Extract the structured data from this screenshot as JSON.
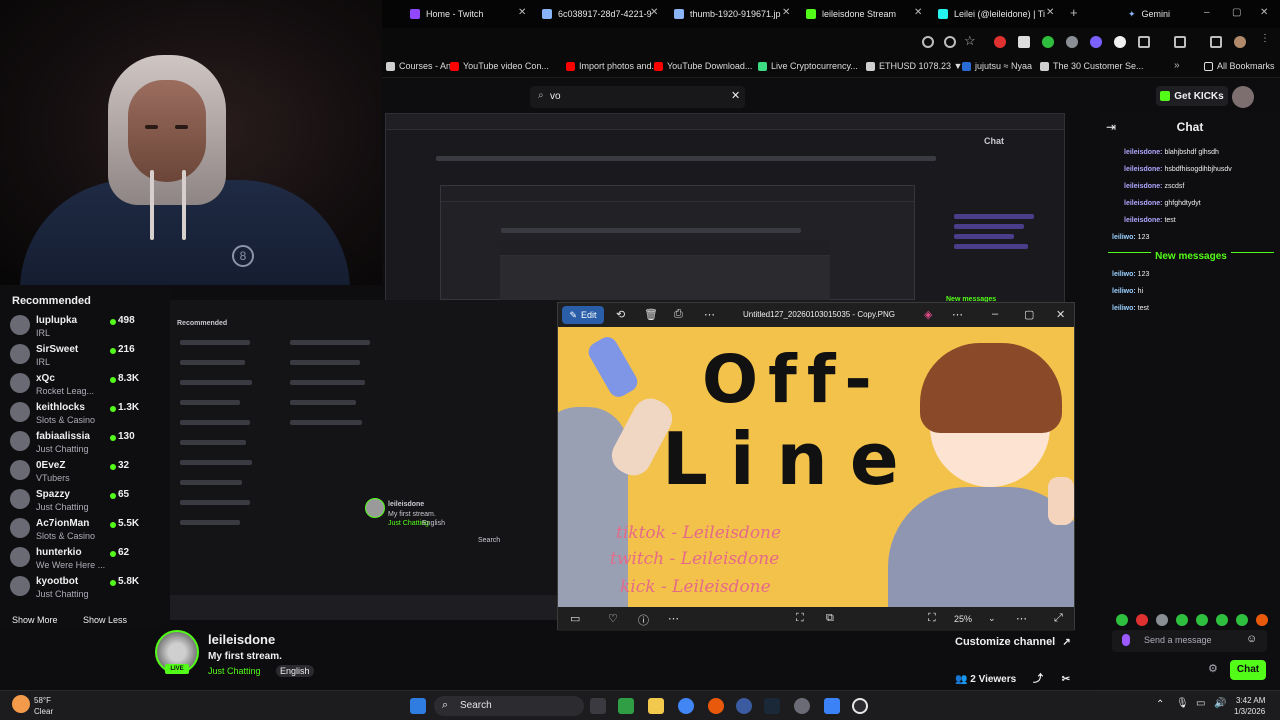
{
  "browser": {
    "tabs": [
      {
        "label": "Home - Twitch",
        "color": "#9146ff"
      },
      {
        "label": "6c038917-28d7-4221-9",
        "color": "#8ab4f8"
      },
      {
        "label": "thumb-1920-919671.jp",
        "color": "#8ab4f8"
      },
      {
        "label": "leileisdone Stream",
        "color": "#53fc18"
      },
      {
        "label": "Leilei (@leileidone) | Ti",
        "color": "#25f4ee"
      }
    ],
    "gemini_label": "Gemini",
    "bookmarks": [
      {
        "label": "Courses - An...",
        "color": "#cfcfcf"
      },
      {
        "label": "YouTube video Con...",
        "color": "#ff0000"
      },
      {
        "label": "Import photos and...",
        "color": "#ff0000"
      },
      {
        "label": "YouTube Download...",
        "color": "#ff0000"
      },
      {
        "label": "Live Cryptocurrency...",
        "color": "#3ddc84"
      },
      {
        "label": "ETHUSD 1078.23 ▼",
        "color": "#cfcfcf"
      },
      {
        "label": "jujutsu ≈ Nyaa",
        "color": "#2a6cd6"
      },
      {
        "label": "The 30 Customer Se...",
        "color": "#cfcfcf"
      }
    ],
    "all_bookmarks": "All Bookmarks"
  },
  "search": {
    "value": "vo",
    "clear_icon": "close-icon"
  },
  "header": {
    "get_kicks": "Get KICKs"
  },
  "recommended": {
    "title": "Recommended",
    "items": [
      {
        "name": "luplupka",
        "category": "IRL",
        "viewers": "498"
      },
      {
        "name": "SirSweet",
        "category": "IRL",
        "viewers": "216"
      },
      {
        "name": "xQc",
        "category": "Rocket Leag...",
        "viewers": "8.3K"
      },
      {
        "name": "keithlocks",
        "category": "Slots & Casino",
        "viewers": "1.3K"
      },
      {
        "name": "fabiaalissia",
        "category": "Just Chatting",
        "viewers": "130"
      },
      {
        "name": "0EveZ",
        "category": "VTubers",
        "viewers": "32"
      },
      {
        "name": "Spazzy",
        "category": "Just Chatting",
        "viewers": "65"
      },
      {
        "name": "Ac7ionMan",
        "category": "Slots & Casino",
        "viewers": "5.5K"
      },
      {
        "name": "hunterkio",
        "category": "We Were Here ...",
        "viewers": "62"
      },
      {
        "name": "kyootbot",
        "category": "Just Chatting",
        "viewers": "5.8K"
      }
    ],
    "show_more": "Show More",
    "show_less": "Show Less"
  },
  "chat": {
    "title": "Chat",
    "messages": [
      {
        "user": "leileisdone:",
        "text": " blahjbshdf glhsdh"
      },
      {
        "user": "leileisdone:",
        "text": " hsbdfhisogdihbjhusdv"
      },
      {
        "user": "leileisdone:",
        "text": " zscdsf"
      },
      {
        "user": "leileisdone:",
        "text": " ghfghdtydyt"
      },
      {
        "user": "leileisdone:",
        "text": " test"
      },
      {
        "user": "leiliwo:",
        "text": " 123"
      }
    ],
    "new_messages": "New messages",
    "new_messages_list": [
      {
        "user": "leiliwo:",
        "text": " 123"
      },
      {
        "user": "leiliwo:",
        "text": " hi"
      },
      {
        "user": "leiliwo:",
        "text": " test"
      }
    ],
    "send_placeholder": "Send a message",
    "chat_button": "Chat"
  },
  "viewer": {
    "edit_label": "Edit",
    "filename": "Untitled127_20260103015035 - Copy.PNG",
    "zoom": "25%",
    "art_title_1": "Off-",
    "art_title_2": "Line",
    "socials": [
      "tiktok - Leileisdone",
      "twitch - Leileisdone",
      "kick - Leileisdone"
    ]
  },
  "stream": {
    "name": "leileisdone",
    "title": "My first stream.",
    "category": "Just Chatting",
    "tag": "English",
    "live_badge": "LIVE"
  },
  "customize_channel": "Customize channel",
  "viewers": "2 Viewers",
  "taskbar": {
    "weather_temp": "58°F",
    "weather_desc": "Clear",
    "search_label": "Search",
    "time": "3:42 AM",
    "date": "1/3/2026"
  },
  "nested": {
    "recommended_title": "Recommended",
    "chat_title": "Chat",
    "new_messages": "New messages",
    "stream_name": "leileisdone",
    "stream_title": "My first stream.",
    "stream_cat": "Just Chatting",
    "stream_tag": "English",
    "search_label": "Search"
  },
  "colors": {
    "accent": "#53fc18",
    "twitch": "#9146ff"
  }
}
